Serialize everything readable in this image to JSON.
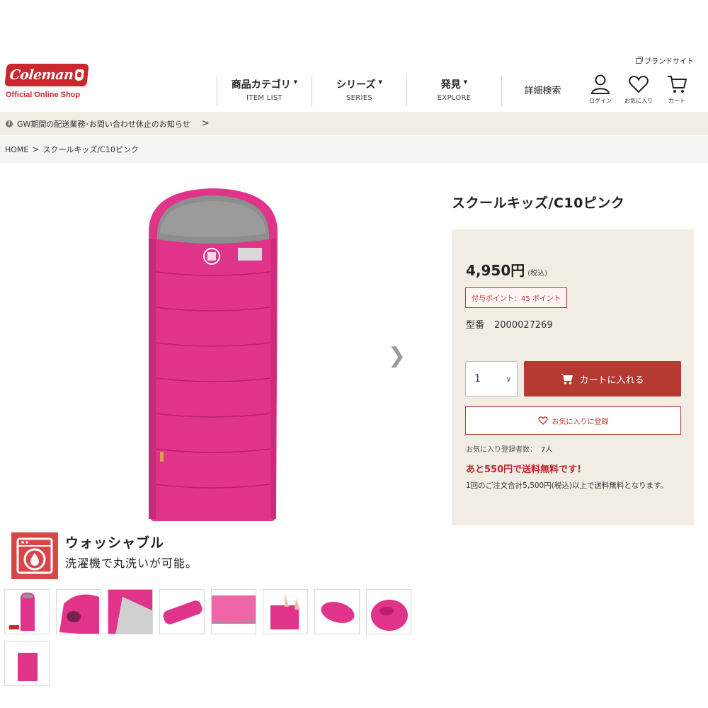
{
  "header": {
    "brand_site_label": "ブランドサイト",
    "logo_text": "Coleman",
    "logo_subtitle": "Official Online Shop",
    "nav": [
      {
        "label": "商品カテゴリ",
        "sub": "ITEM LIST"
      },
      {
        "label": "シリーズ",
        "sub": "SERIES"
      },
      {
        "label": "発見",
        "sub": "EXPLORE"
      }
    ],
    "detail_search_label": "詳細検索",
    "icons": {
      "login_label": "ログイン",
      "favorites_label": "お気に入り",
      "cart_label": "カート"
    },
    "accent_color": "#c8282e"
  },
  "notice": {
    "text": "GW期間の配送業務･お問い合わせ休止のお知らせ"
  },
  "breadcrumb": {
    "home": "HOME",
    "current": "スクールキッズ/C10ピンク"
  },
  "gallery": {
    "feature_title": "ウォッシャブル",
    "feature_desc": "洗濯機で丸洗いが可能。",
    "main_image": "pink-sleeping-bag",
    "thumbnails": [
      "sleeping-bag-front",
      "hood-detail",
      "lining-detail",
      "rolled-side",
      "zipper-detail",
      "hands-demo",
      "rolled-bag",
      "storage-bag",
      "label-detail"
    ]
  },
  "product": {
    "title": "スクールキッズ/C10ピンク",
    "price": "4,950円",
    "tax_note": "(税込)",
    "points": "付与ポイント：45 ポイント",
    "model_label": "型番",
    "model_number": "2000027269",
    "quantity": "1",
    "add_to_cart": "カートに入れる",
    "add_favorite": "お気に入りに登録",
    "fav_count_label": "お気に入り登録者数：",
    "fav_count": "7人",
    "free_shipping": "あと550円で送料無料です!",
    "shipping_note": "1回のご注文合計5,500円(税込)以上で送料無料となります。",
    "button_color": "#b53a32",
    "panel_color": "#f1ece4"
  }
}
